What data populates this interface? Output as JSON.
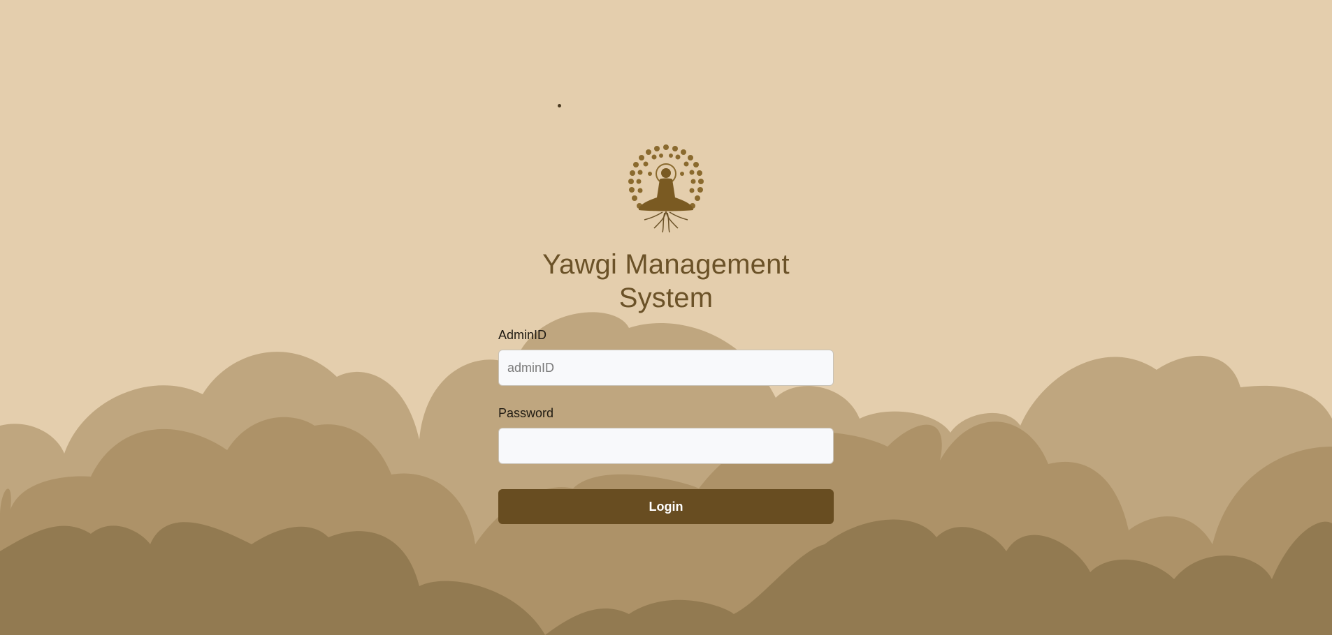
{
  "app": {
    "title": "Yawgi Management System",
    "logo_icon": "meditating-figure-tree-icon"
  },
  "form": {
    "admin_label": "AdminID",
    "admin_placeholder": "adminID",
    "admin_value": "",
    "password_label": "Password",
    "password_value": "",
    "login_label": "Login"
  },
  "colors": {
    "background": "#e4cead",
    "brand": "#684d21",
    "title": "#6b5228",
    "hill_light": "#bfa67f",
    "hill_mid": "#ad9268",
    "hill_dark": "#927a51"
  }
}
